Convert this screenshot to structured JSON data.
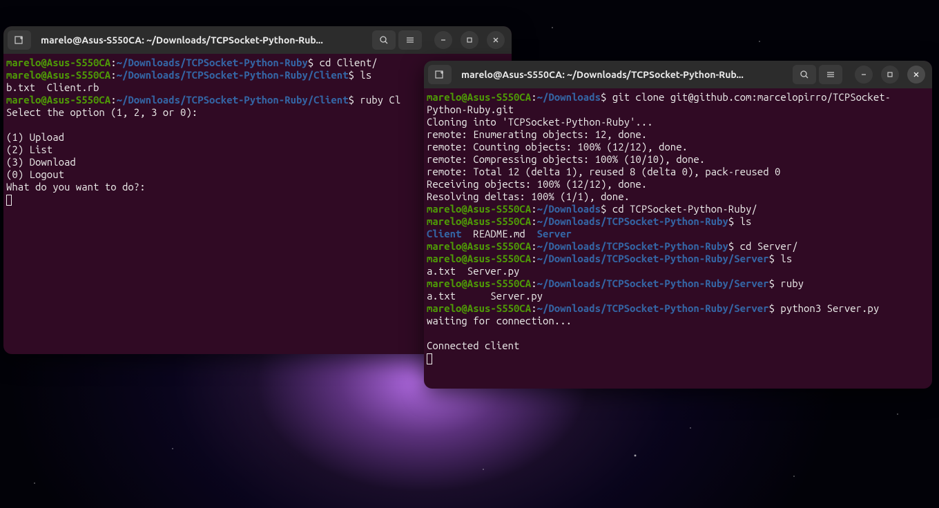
{
  "terminal1": {
    "title": "marelo@Asus-S550CA: ~/Downloads/TCPSocket-Python-Rub...",
    "lines": {
      "l1_user": "marelo@Asus-S550CA",
      "l1_sep": ":",
      "l1_path": "~/Downloads/TCPSocket-Python-Ruby",
      "l1_cmd": "$ cd Client/",
      "l2_user": "marelo@Asus-S550CA",
      "l2_path": "~/Downloads/TCPSocket-Python-Ruby/Client",
      "l2_cmd": "$ ls",
      "l3": "b.txt  Client.rb",
      "l4_user": "marelo@Asus-S550CA",
      "l4_path": "~/Downloads/TCPSocket-Python-Ruby/Client",
      "l4_cmd": "$ ruby Cl",
      "l5": "Select the option (1, 2, 3 or 0):",
      "l6": "",
      "l7": "(1) Upload",
      "l8": "(2) List",
      "l9": "(3) Download",
      "l10": "(0) Logout",
      "l11": "What do you want to do?:"
    }
  },
  "terminal2": {
    "title": "marelo@Asus-S550CA: ~/Downloads/TCPSocket-Python-Rub...",
    "lines": {
      "l1_user": "marelo@Asus-S550CA",
      "l1_sep": ":",
      "l1_path": "~/Downloads",
      "l1_cmd": "$ git clone git@github.com:marcelopirro/TCPSocket-",
      "l2": "Python-Ruby.git",
      "l3": "Cloning into 'TCPSocket-Python-Ruby'...",
      "l4": "remote: Enumerating objects: 12, done.",
      "l5": "remote: Counting objects: 100% (12/12), done.",
      "l6": "remote: Compressing objects: 100% (10/10), done.",
      "l7": "remote: Total 12 (delta 1), reused 8 (delta 0), pack-reused 0",
      "l8": "Receiving objects: 100% (12/12), done.",
      "l9": "Resolving deltas: 100% (1/1), done.",
      "l10_user": "marelo@Asus-S550CA",
      "l10_path": "~/Downloads",
      "l10_cmd": "$ cd TCPSocket-Python-Ruby/",
      "l11_user": "marelo@Asus-S550CA",
      "l11_path": "~/Downloads/TCPSocket-Python-Ruby",
      "l11_cmd": "$ ls",
      "l12_d1": "Client",
      "l12_mid": "  README.md  ",
      "l12_d2": "Server",
      "l13_user": "marelo@Asus-S550CA",
      "l13_path": "~/Downloads/TCPSocket-Python-Ruby",
      "l13_cmd": "$ cd Server/",
      "l14_user": "marelo@Asus-S550CA",
      "l14_path": "~/Downloads/TCPSocket-Python-Ruby/Server",
      "l14_cmd": "$ ls",
      "l15": "a.txt  Server.py",
      "l16_user": "marelo@Asus-S550CA",
      "l16_path": "~/Downloads/TCPSocket-Python-Ruby/Server",
      "l16_cmd": "$ ruby",
      "l17": "a.txt      Server.py",
      "l18_user": "marelo@Asus-S550CA",
      "l18_path": "~/Downloads/TCPSocket-Python-Ruby/Server",
      "l18_cmd": "$ python3 Server.py",
      "l19": "waiting for connection...",
      "l20": "",
      "l21": "Connected client"
    }
  }
}
